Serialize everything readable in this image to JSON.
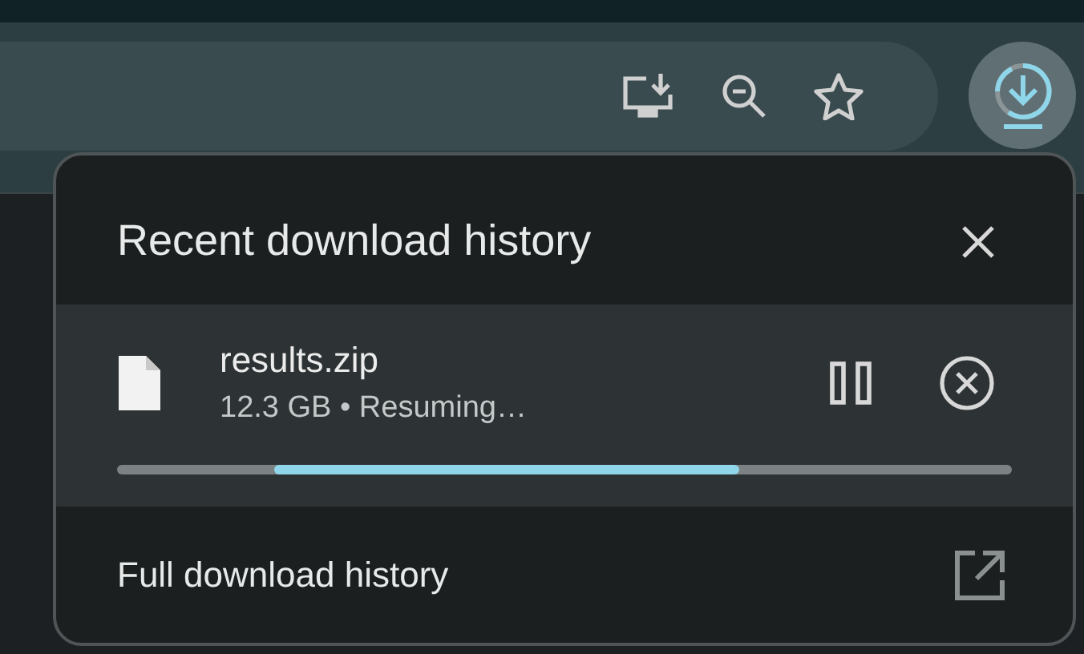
{
  "popup": {
    "title": "Recent download history",
    "item": {
      "name": "results.zip",
      "details": "12.3 GB • Resuming…",
      "paused": false,
      "indeterminate": true
    },
    "footer": "Full download history"
  }
}
